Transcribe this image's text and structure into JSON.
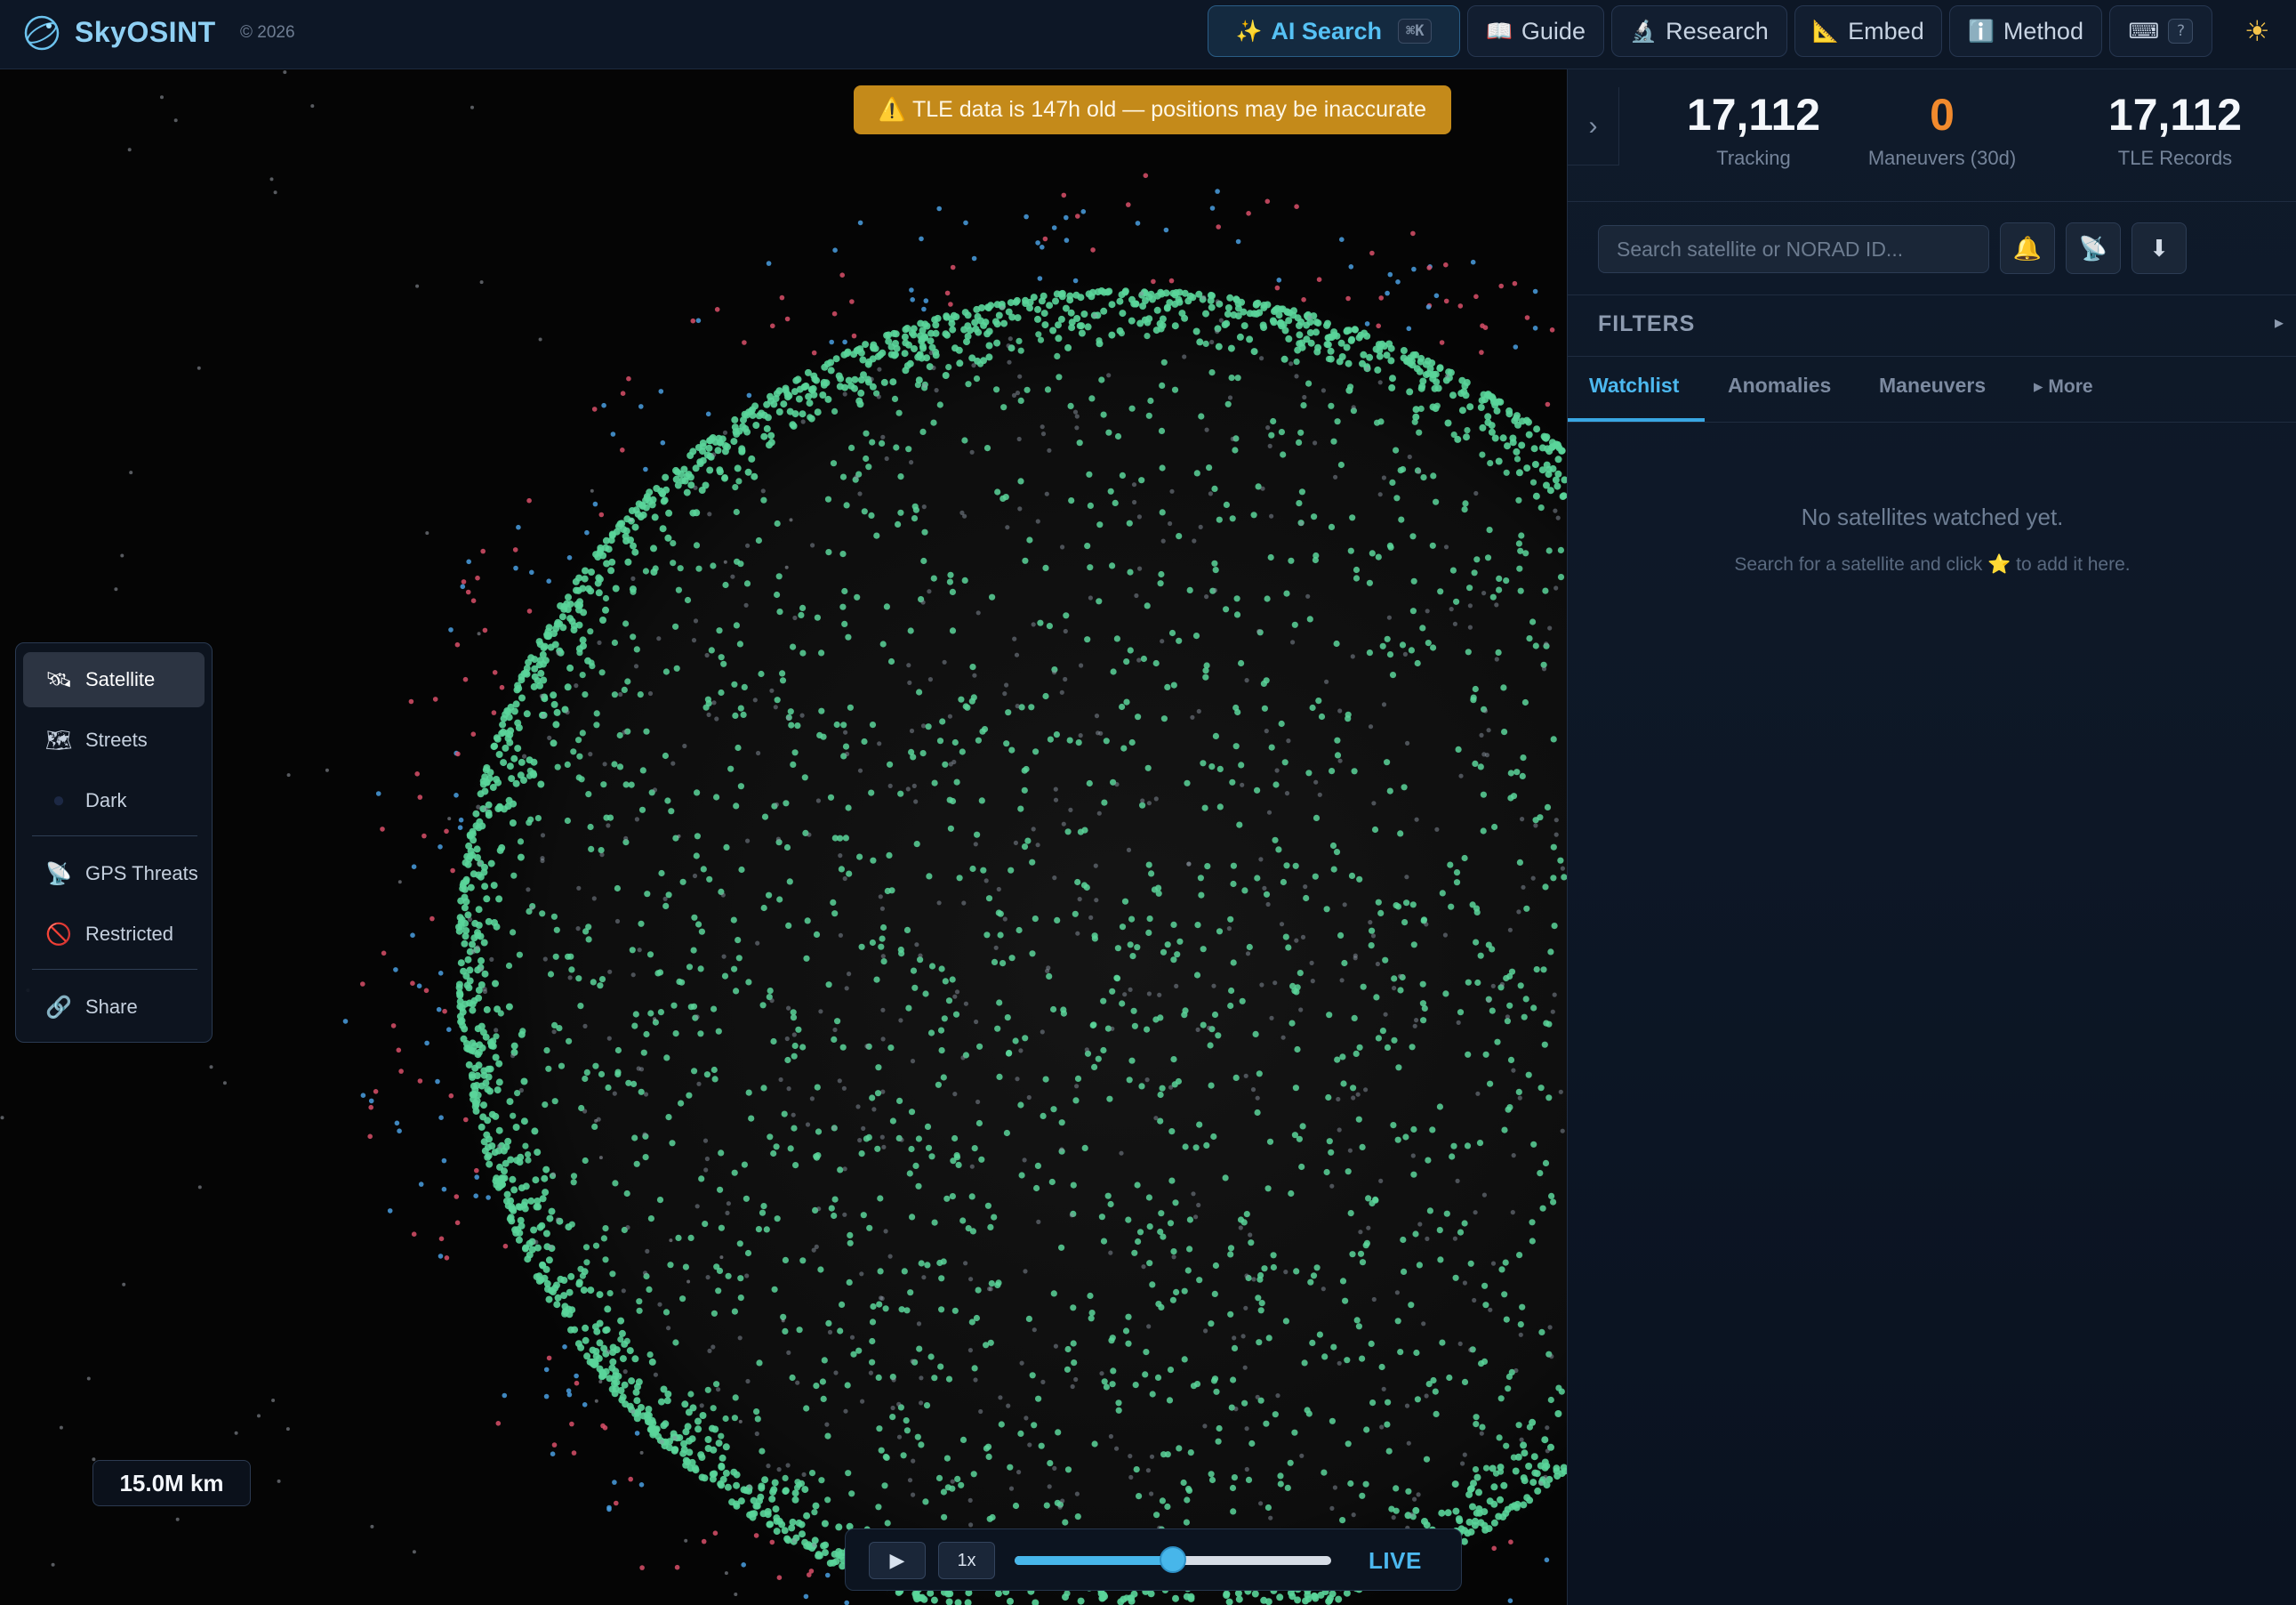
{
  "app": {
    "brand": "SkyOSINT",
    "copyright": "© 2026"
  },
  "nav": {
    "ai_search": {
      "icon": "✨",
      "label": "AI Search",
      "shortcut": "⌘K"
    },
    "guide": {
      "icon": "📖",
      "label": "Guide"
    },
    "research": {
      "icon": "🔬",
      "label": "Research"
    },
    "embed": {
      "icon": "📐",
      "label": "Embed"
    },
    "method": {
      "icon": "ℹ️",
      "label": "Method"
    },
    "keyboard": {
      "icon": "⌨",
      "shortcut": "?"
    },
    "theme_icon": "☀"
  },
  "banner": {
    "icon": "⚠️",
    "text": "TLE data is 147h old — positions may be inaccurate"
  },
  "layers": {
    "items": [
      {
        "icon": "🛰",
        "label": "Satellite",
        "active": true
      },
      {
        "icon": "🗺",
        "label": "Streets",
        "active": false
      },
      {
        "icon": "●",
        "label": "Dark",
        "active": false
      }
    ],
    "overlays": [
      {
        "icon": "📡",
        "label": "GPS Threats"
      },
      {
        "icon": "🚫",
        "label": "Restricted"
      }
    ],
    "share": {
      "icon": "🔗",
      "label": "Share"
    }
  },
  "scale": {
    "label": "15.0M km"
  },
  "timebar": {
    "play_icon": "▶",
    "speed": "1x",
    "position": 0.5,
    "live_label": "LIVE"
  },
  "stats": [
    {
      "value": "17,112",
      "label": "Tracking",
      "color": "#f4f7fb"
    },
    {
      "value": "0",
      "label": "Maneuvers (30d)",
      "color": "#f18a2d"
    },
    {
      "value": "17,112",
      "label": "TLE Records",
      "color": "#f4f7fb"
    }
  ],
  "panel": {
    "collapse_icon": "›",
    "search_placeholder": "Search satellite or NORAD ID...",
    "alert_icon": "🔔",
    "dish_icon": "📡",
    "download_icon": "⬇",
    "filters_label": "FILTERS",
    "filters_arrow": "▸",
    "tabs": [
      {
        "label": "Watchlist",
        "active": true
      },
      {
        "label": "Anomalies",
        "active": false
      },
      {
        "label": "Maneuvers",
        "active": false
      }
    ],
    "more_tab": "▸ More",
    "empty_title": "No satellites watched yet.",
    "empty_sub_before": "Search for a satellite and click ",
    "empty_sub_star": "⭐",
    "empty_sub_after": " to add it here."
  },
  "colors": {
    "accent": "#4cb8ef",
    "warning": "#c48a1a",
    "leo_dot": "#5ad59a",
    "meo_dot": "#4a9fe0",
    "geo_dot": "#d9506a"
  }
}
